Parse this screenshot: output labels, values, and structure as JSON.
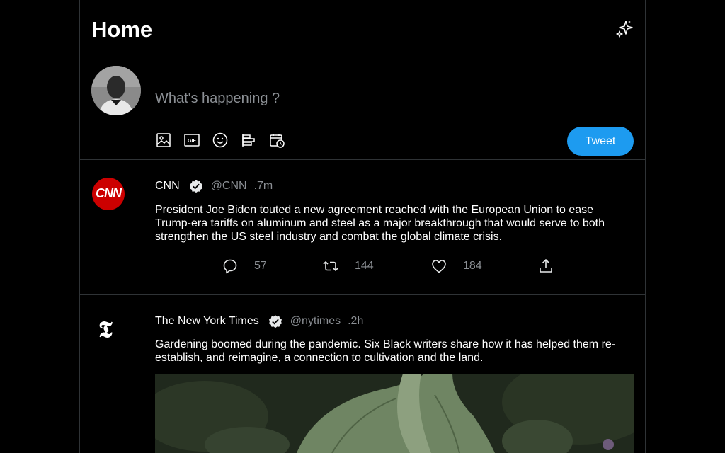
{
  "header": {
    "title": "Home"
  },
  "composer": {
    "placeholder": "What's happening ?",
    "tweet_label": "Tweet"
  },
  "posts": [
    {
      "name": "CNN",
      "handle": "@CNN",
      "age": ".7m",
      "logo_text": "CNN",
      "text": "President Joe Biden touted a new agreement reached with the European Union to ease Trump-era tariffs on aluminum and steel as a major breakthrough that would serve to both strengthen the US steel industry and combat the global climate crisis.",
      "replies": "57",
      "retweets": "144",
      "likes": "184"
    },
    {
      "name": "The New York Times",
      "handle": "@nytimes",
      "age": ".2h",
      "logo_text": "𝕿",
      "text": "Gardening boomed during the pandemic. Six Black writers share how it has helped them re-establish, and reimagine, a connection to cultivation and the land."
    }
  ],
  "colors": {
    "accent": "#1d9bf0",
    "border": "#2f3336",
    "muted": "#8b8f94",
    "cnn_red": "#cc0000"
  }
}
